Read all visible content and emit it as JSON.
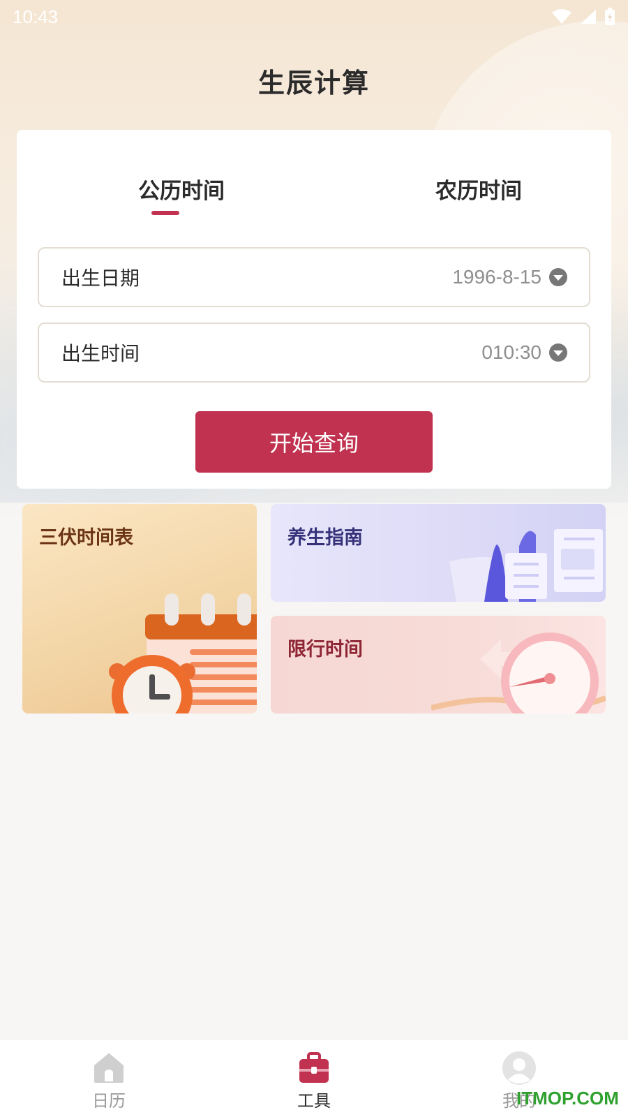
{
  "status_bar": {
    "time": "10:43"
  },
  "page": {
    "title": "生辰计算"
  },
  "tabs": [
    {
      "label": "公历时间",
      "active": true
    },
    {
      "label": "农历时间",
      "active": false
    }
  ],
  "form": {
    "birth_date": {
      "label": "出生日期",
      "value": "1996-8-15"
    },
    "birth_time": {
      "label": "出生时间",
      "value": "010:30"
    },
    "submit_label": "开始查询"
  },
  "tools": [
    {
      "title": "三伏时间表",
      "icon": "alarm-clock-calendar-illustration"
    },
    {
      "title": "养生指南",
      "icon": "health-chart-illustration"
    },
    {
      "title": "限行时间",
      "icon": "speedometer-illustration"
    }
  ],
  "bottom_nav": [
    {
      "label": "日历",
      "icon": "home-icon",
      "active": false
    },
    {
      "label": "工具",
      "icon": "toolbox-icon",
      "active": true
    },
    {
      "label": "我的",
      "icon": "user-avatar-icon",
      "active": false
    }
  ],
  "watermark": "ITMOP.COM",
  "colors": {
    "accent": "#c0324f",
    "title_text": "#2b2b2b",
    "muted_text": "#8e8e8e"
  }
}
